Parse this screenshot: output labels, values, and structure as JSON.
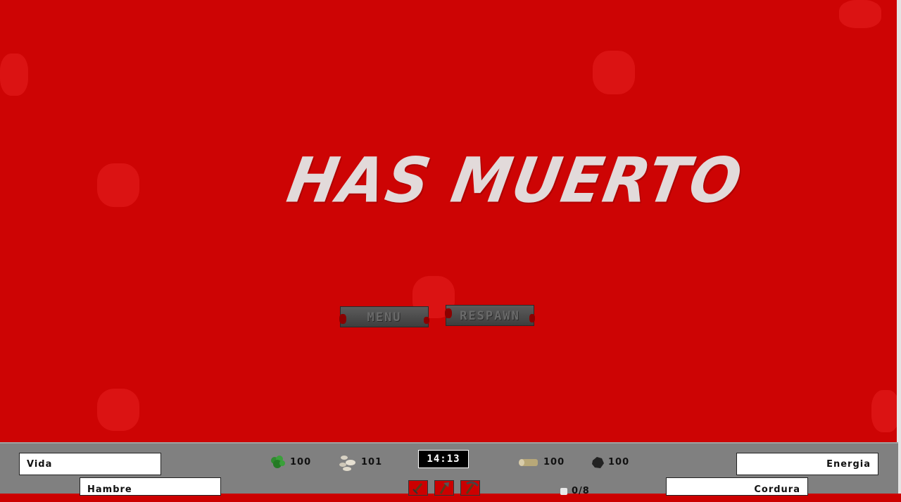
{
  "screen": {
    "title": "HAS MUERTO",
    "buttons": {
      "menu": "MENU",
      "respawn": "RESPAWN"
    }
  },
  "hud": {
    "stats": {
      "vida": "Vida",
      "hambre": "Hambre",
      "energia": "Energia",
      "cordura": "Cordura"
    },
    "resources": {
      "plant": {
        "icon": "leaf-icon",
        "value": "100"
      },
      "stone": {
        "icon": "stone-icon",
        "value": "101"
      },
      "wood": {
        "icon": "log-icon",
        "value": "100"
      },
      "coal": {
        "icon": "coal-icon",
        "value": "100"
      },
      "capacity": {
        "icon": "inventory-icon",
        "value": "0/8"
      }
    },
    "clock": "14:13",
    "tools": [
      "sword-icon",
      "axe-icon",
      "pickaxe-icon"
    ]
  },
  "colors": {
    "background": "#cd0404",
    "hud": "#808080",
    "title": "#e2dada"
  }
}
